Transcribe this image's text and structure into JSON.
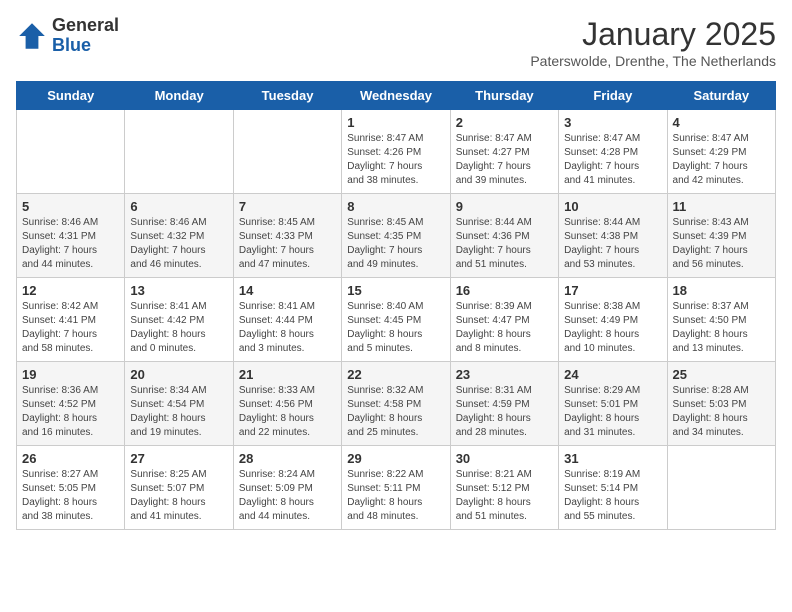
{
  "header": {
    "logo_general": "General",
    "logo_blue": "Blue",
    "month_title": "January 2025",
    "subtitle": "Paterswolde, Drenthe, The Netherlands"
  },
  "weekdays": [
    "Sunday",
    "Monday",
    "Tuesday",
    "Wednesday",
    "Thursday",
    "Friday",
    "Saturday"
  ],
  "weeks": [
    [
      {
        "day": "",
        "info": ""
      },
      {
        "day": "",
        "info": ""
      },
      {
        "day": "",
        "info": ""
      },
      {
        "day": "1",
        "info": "Sunrise: 8:47 AM\nSunset: 4:26 PM\nDaylight: 7 hours\nand 38 minutes."
      },
      {
        "day": "2",
        "info": "Sunrise: 8:47 AM\nSunset: 4:27 PM\nDaylight: 7 hours\nand 39 minutes."
      },
      {
        "day": "3",
        "info": "Sunrise: 8:47 AM\nSunset: 4:28 PM\nDaylight: 7 hours\nand 41 minutes."
      },
      {
        "day": "4",
        "info": "Sunrise: 8:47 AM\nSunset: 4:29 PM\nDaylight: 7 hours\nand 42 minutes."
      }
    ],
    [
      {
        "day": "5",
        "info": "Sunrise: 8:46 AM\nSunset: 4:31 PM\nDaylight: 7 hours\nand 44 minutes."
      },
      {
        "day": "6",
        "info": "Sunrise: 8:46 AM\nSunset: 4:32 PM\nDaylight: 7 hours\nand 46 minutes."
      },
      {
        "day": "7",
        "info": "Sunrise: 8:45 AM\nSunset: 4:33 PM\nDaylight: 7 hours\nand 47 minutes."
      },
      {
        "day": "8",
        "info": "Sunrise: 8:45 AM\nSunset: 4:35 PM\nDaylight: 7 hours\nand 49 minutes."
      },
      {
        "day": "9",
        "info": "Sunrise: 8:44 AM\nSunset: 4:36 PM\nDaylight: 7 hours\nand 51 minutes."
      },
      {
        "day": "10",
        "info": "Sunrise: 8:44 AM\nSunset: 4:38 PM\nDaylight: 7 hours\nand 53 minutes."
      },
      {
        "day": "11",
        "info": "Sunrise: 8:43 AM\nSunset: 4:39 PM\nDaylight: 7 hours\nand 56 minutes."
      }
    ],
    [
      {
        "day": "12",
        "info": "Sunrise: 8:42 AM\nSunset: 4:41 PM\nDaylight: 7 hours\nand 58 minutes."
      },
      {
        "day": "13",
        "info": "Sunrise: 8:41 AM\nSunset: 4:42 PM\nDaylight: 8 hours\nand 0 minutes."
      },
      {
        "day": "14",
        "info": "Sunrise: 8:41 AM\nSunset: 4:44 PM\nDaylight: 8 hours\nand 3 minutes."
      },
      {
        "day": "15",
        "info": "Sunrise: 8:40 AM\nSunset: 4:45 PM\nDaylight: 8 hours\nand 5 minutes."
      },
      {
        "day": "16",
        "info": "Sunrise: 8:39 AM\nSunset: 4:47 PM\nDaylight: 8 hours\nand 8 minutes."
      },
      {
        "day": "17",
        "info": "Sunrise: 8:38 AM\nSunset: 4:49 PM\nDaylight: 8 hours\nand 10 minutes."
      },
      {
        "day": "18",
        "info": "Sunrise: 8:37 AM\nSunset: 4:50 PM\nDaylight: 8 hours\nand 13 minutes."
      }
    ],
    [
      {
        "day": "19",
        "info": "Sunrise: 8:36 AM\nSunset: 4:52 PM\nDaylight: 8 hours\nand 16 minutes."
      },
      {
        "day": "20",
        "info": "Sunrise: 8:34 AM\nSunset: 4:54 PM\nDaylight: 8 hours\nand 19 minutes."
      },
      {
        "day": "21",
        "info": "Sunrise: 8:33 AM\nSunset: 4:56 PM\nDaylight: 8 hours\nand 22 minutes."
      },
      {
        "day": "22",
        "info": "Sunrise: 8:32 AM\nSunset: 4:58 PM\nDaylight: 8 hours\nand 25 minutes."
      },
      {
        "day": "23",
        "info": "Sunrise: 8:31 AM\nSunset: 4:59 PM\nDaylight: 8 hours\nand 28 minutes."
      },
      {
        "day": "24",
        "info": "Sunrise: 8:29 AM\nSunset: 5:01 PM\nDaylight: 8 hours\nand 31 minutes."
      },
      {
        "day": "25",
        "info": "Sunrise: 8:28 AM\nSunset: 5:03 PM\nDaylight: 8 hours\nand 34 minutes."
      }
    ],
    [
      {
        "day": "26",
        "info": "Sunrise: 8:27 AM\nSunset: 5:05 PM\nDaylight: 8 hours\nand 38 minutes."
      },
      {
        "day": "27",
        "info": "Sunrise: 8:25 AM\nSunset: 5:07 PM\nDaylight: 8 hours\nand 41 minutes."
      },
      {
        "day": "28",
        "info": "Sunrise: 8:24 AM\nSunset: 5:09 PM\nDaylight: 8 hours\nand 44 minutes."
      },
      {
        "day": "29",
        "info": "Sunrise: 8:22 AM\nSunset: 5:11 PM\nDaylight: 8 hours\nand 48 minutes."
      },
      {
        "day": "30",
        "info": "Sunrise: 8:21 AM\nSunset: 5:12 PM\nDaylight: 8 hours\nand 51 minutes."
      },
      {
        "day": "31",
        "info": "Sunrise: 8:19 AM\nSunset: 5:14 PM\nDaylight: 8 hours\nand 55 minutes."
      },
      {
        "day": "",
        "info": ""
      }
    ]
  ]
}
